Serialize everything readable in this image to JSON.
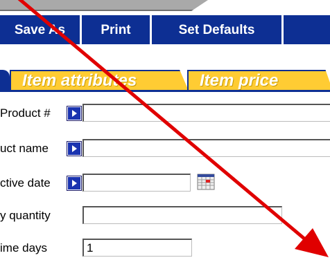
{
  "toolbar": {
    "save_as": "Save As",
    "print": "Print",
    "set_defaults": "Set Defaults"
  },
  "tabs": {
    "item_attributes": "Item attributes",
    "item_price": "Item price"
  },
  "form": {
    "product_no_label": "Product #",
    "product_name_label": "uct name",
    "active_date_label": "ctive date",
    "quantity_label": "y quantity",
    "time_days_label": "ime days",
    "product_no_value": "",
    "product_name_value": "",
    "active_date_value": "",
    "quantity_value": "",
    "time_days_value": "1"
  },
  "colors": {
    "toolbar_blue": "#0d2f93",
    "tab_yellow": "#ffcc33",
    "annotation_red": "#e00000"
  },
  "icons": {
    "lookup": "lookup-arrow-icon",
    "calendar": "calendar-icon"
  }
}
